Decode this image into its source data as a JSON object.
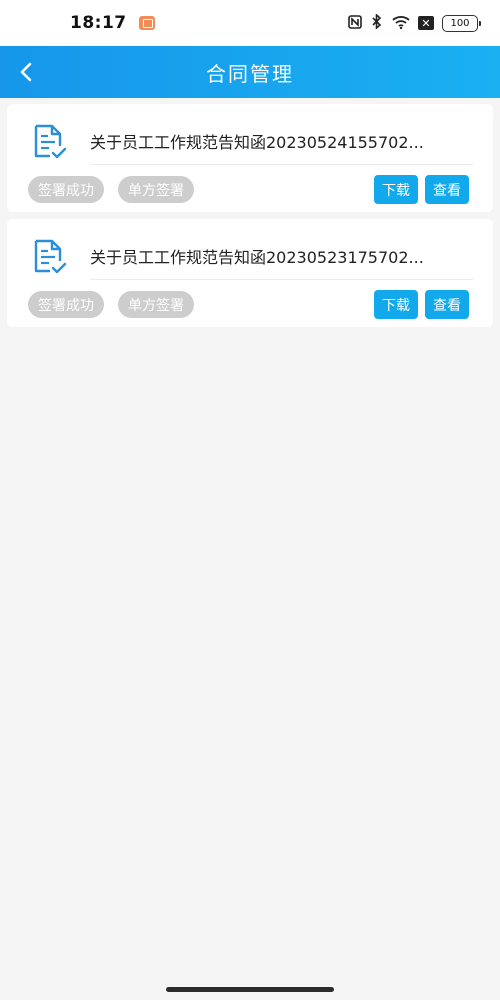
{
  "status_bar": {
    "time": "18:17",
    "battery": "100"
  },
  "header": {
    "title": "合同管理"
  },
  "contracts": [
    {
      "title": "关于员工工作规范告知函20230524155702...",
      "tags": [
        "签署成功",
        "单方签署"
      ],
      "download_label": "下载",
      "view_label": "查看"
    },
    {
      "title": "关于员工工作规范告知函20230523175702...",
      "tags": [
        "签署成功",
        "单方签署"
      ],
      "download_label": "下载",
      "view_label": "查看"
    }
  ],
  "colors": {
    "header": "#1697ea",
    "button": "#12a9ec",
    "tag": "#cdcdcd",
    "icon": "#2a8fd8"
  },
  "icons": [
    "back-arrow-icon",
    "document-check-icon",
    "nfc-icon",
    "bluetooth-icon",
    "wifi-icon",
    "battery-icon"
  ]
}
